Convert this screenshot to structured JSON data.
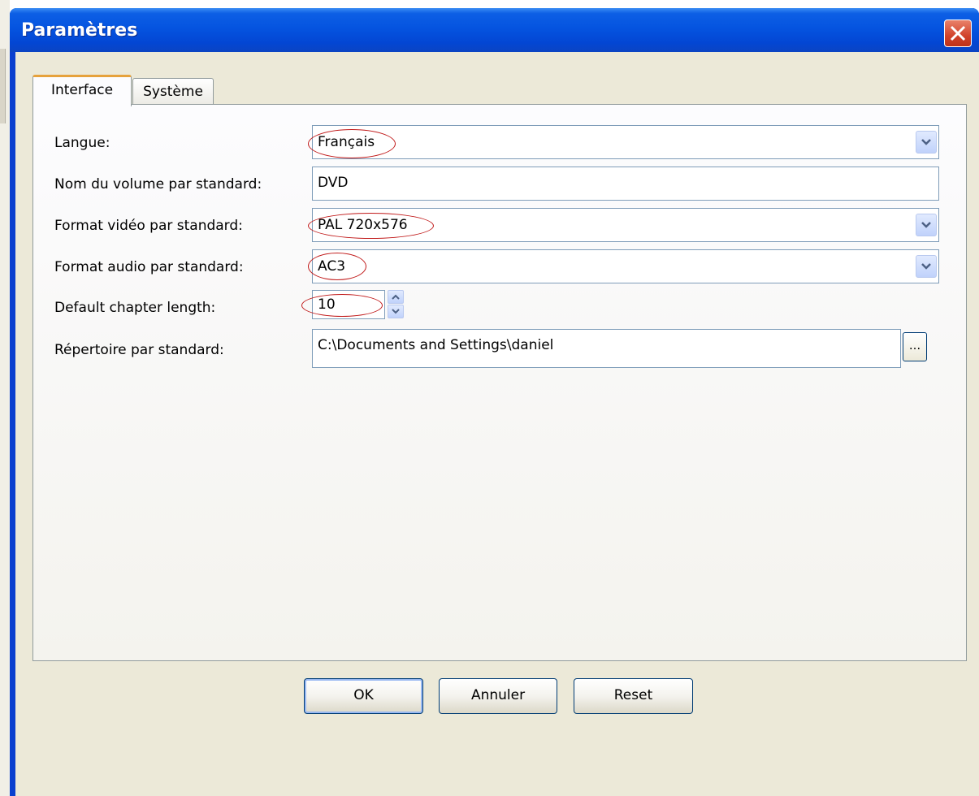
{
  "window": {
    "title": "Paramètres"
  },
  "tabs": [
    {
      "label": "Interface",
      "active": true
    },
    {
      "label": "Système",
      "active": false
    }
  ],
  "form": {
    "language": {
      "label": "Langue:",
      "value": "Français"
    },
    "volume_name": {
      "label": "Nom du volume par standard:",
      "value": "DVD"
    },
    "video_format": {
      "label": "Format vidéo par standard:",
      "value": "PAL 720x576"
    },
    "audio_format": {
      "label": "Format audio par standard:",
      "value": "AC3"
    },
    "chapter_length": {
      "label": "Default chapter length:",
      "value": "10"
    },
    "directory": {
      "label": "Répertoire par standard:",
      "value": "C:\\Documents and Settings\\daniel",
      "browse_label": "..."
    }
  },
  "buttons": {
    "ok": "OK",
    "cancel": "Annuler",
    "reset": "Reset"
  },
  "colors": {
    "titlebar": "#0554e0",
    "dialog_bg": "#ece9d8",
    "annotation_ellipse": "#c01818",
    "close_button": "#d1432b"
  }
}
